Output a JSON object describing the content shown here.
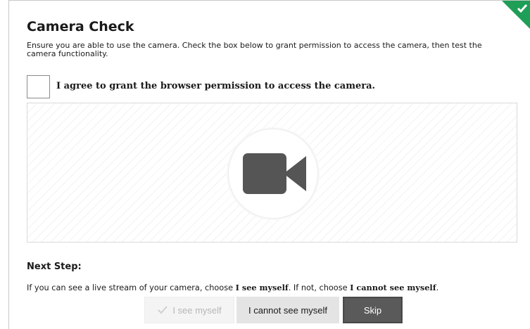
{
  "title": "Camera Check",
  "description": "Ensure you are able to use the camera. Check the box below to grant permission to access the camera, then test the camera functionality.",
  "permission": {
    "label": "I agree to grant the browser permission to access the camera.",
    "checked": false
  },
  "camera_preview": {
    "icon": "video-camera-icon"
  },
  "next_step": {
    "title": "Next Step:",
    "text_1": "If you can see a live stream of your camera, choose ",
    "bold_1": "I see myself",
    "text_2": ". If not, choose ",
    "bold_2": "I cannot see myself",
    "text_3": "."
  },
  "buttons": {
    "see_myself": "I see myself",
    "cannot_see": "I cannot see myself",
    "skip": "Skip"
  },
  "colors": {
    "accent_green": "#1e9e57",
    "skip_button": "#5a5a5a",
    "camera_icon": "#555555"
  }
}
